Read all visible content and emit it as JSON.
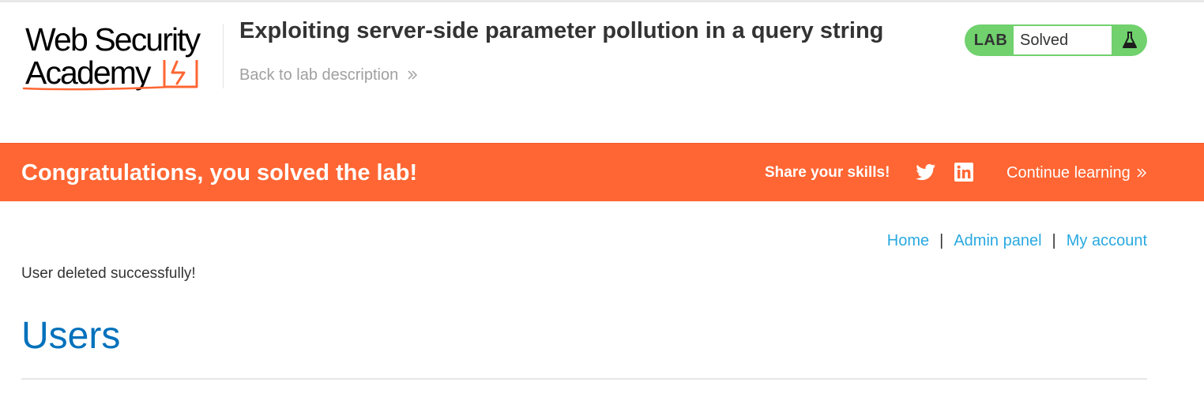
{
  "brand": {
    "logo_line1": "Web Security",
    "logo_line2": "Academy"
  },
  "header": {
    "lab_title": "Exploiting server-side parameter pollution in a query string",
    "back_link": "Back to lab description"
  },
  "lab_status": {
    "label": "LAB",
    "state": "Solved",
    "icon": "flask-icon",
    "color": "#70d16d"
  },
  "banner": {
    "message": "Congratulations, you solved the lab!",
    "share_label": "Share your skills!",
    "share_icons": [
      "twitter-icon",
      "linkedin-icon"
    ],
    "continue_label": "Continue learning",
    "color": "#ff6633"
  },
  "nav": {
    "items": [
      {
        "label": "Home"
      },
      {
        "label": "Admin panel"
      },
      {
        "label": "My account"
      }
    ],
    "separator": "|",
    "link_color": "#29a9e0"
  },
  "main": {
    "message": "User deleted successfully!",
    "heading": "Users",
    "heading_color": "#0071bc"
  }
}
